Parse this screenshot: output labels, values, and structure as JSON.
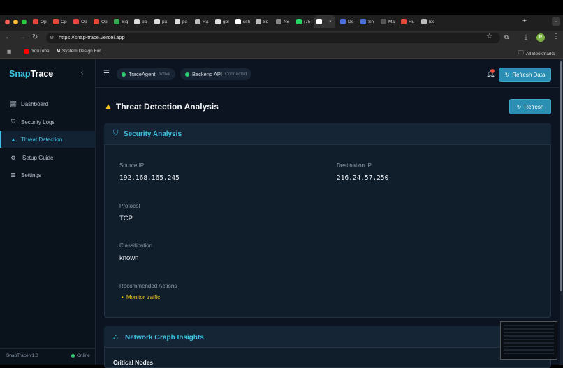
{
  "browser": {
    "tabs": [
      {
        "label": "Op",
        "color": "#e5483a"
      },
      {
        "label": "Op",
        "color": "#e5483a"
      },
      {
        "label": "Op",
        "color": "#e5483a"
      },
      {
        "label": "Op",
        "color": "#e5483a"
      },
      {
        "label": "Sig",
        "color": "#34a853"
      },
      {
        "label": "pa",
        "color": "#dddddd"
      },
      {
        "label": "pa",
        "color": "#dddddd"
      },
      {
        "label": "pa",
        "color": "#dddddd"
      },
      {
        "label": "Ra",
        "color": "#bbbbbb"
      },
      {
        "label": "gol",
        "color": "#dddddd"
      },
      {
        "label": "ssh",
        "color": "#ffffff"
      },
      {
        "label": "8d",
        "color": "#bbbbbb"
      },
      {
        "label": "Ne",
        "color": "#888888"
      },
      {
        "label": "(75",
        "color": "#25d366"
      },
      {
        "label": "",
        "color": "#ffffff"
      },
      {
        "label": "De",
        "color": "#4b6cdf"
      },
      {
        "label": "Sn",
        "color": "#4b6cdf"
      },
      {
        "label": "Ma",
        "color": "#555555"
      },
      {
        "label": "Hu",
        "color": "#e5483a"
      },
      {
        "label": "loc",
        "color": "#bbbbbb"
      }
    ],
    "url": "https://snap-trace.vercel.app",
    "bookmarks": {
      "youtube": "YouTube",
      "system_design": "System Design For...",
      "all": "All Bookmarks"
    },
    "profile_initial": "R"
  },
  "sidebar": {
    "brand_a": "Snap",
    "brand_b": "Trace",
    "collapse_icon": "chevron-left-icon",
    "items": [
      {
        "label": "Dashboard",
        "icon": "chart-line-icon"
      },
      {
        "label": "Security Logs",
        "icon": "shield-icon"
      },
      {
        "label": "Threat Detection",
        "icon": "warning-icon"
      },
      {
        "label": "Setup Guide",
        "icon": "cogs-icon"
      },
      {
        "label": "Settings",
        "icon": "sliders-icon"
      }
    ],
    "version": "SnapTrace v1.0",
    "status": "Online"
  },
  "header": {
    "trace_agent": "TraceAgent",
    "trace_agent_status": "Active",
    "backend_api": "Backend API",
    "backend_status": "Connected",
    "refresh_data": "Refresh Data"
  },
  "main": {
    "title": "Threat Detection Analysis",
    "refresh": "Refresh",
    "security": {
      "heading": "Security Analysis",
      "source_ip_label": "Source IP",
      "source_ip": "192.168.165.245",
      "dest_ip_label": "Destination IP",
      "dest_ip": "216.24.57.250",
      "protocol_label": "Protocol",
      "protocol": "TCP",
      "classification_label": "Classification",
      "classification": "known",
      "actions_label": "Recommended Actions",
      "actions": [
        "Monitor traffic"
      ]
    },
    "network": {
      "heading": "Network Graph Insights",
      "critical_nodes": "Critical Nodes"
    }
  },
  "colors": {
    "accent": "#3fc1e0",
    "warning": "#f5c518",
    "ok": "#2ecc71"
  }
}
